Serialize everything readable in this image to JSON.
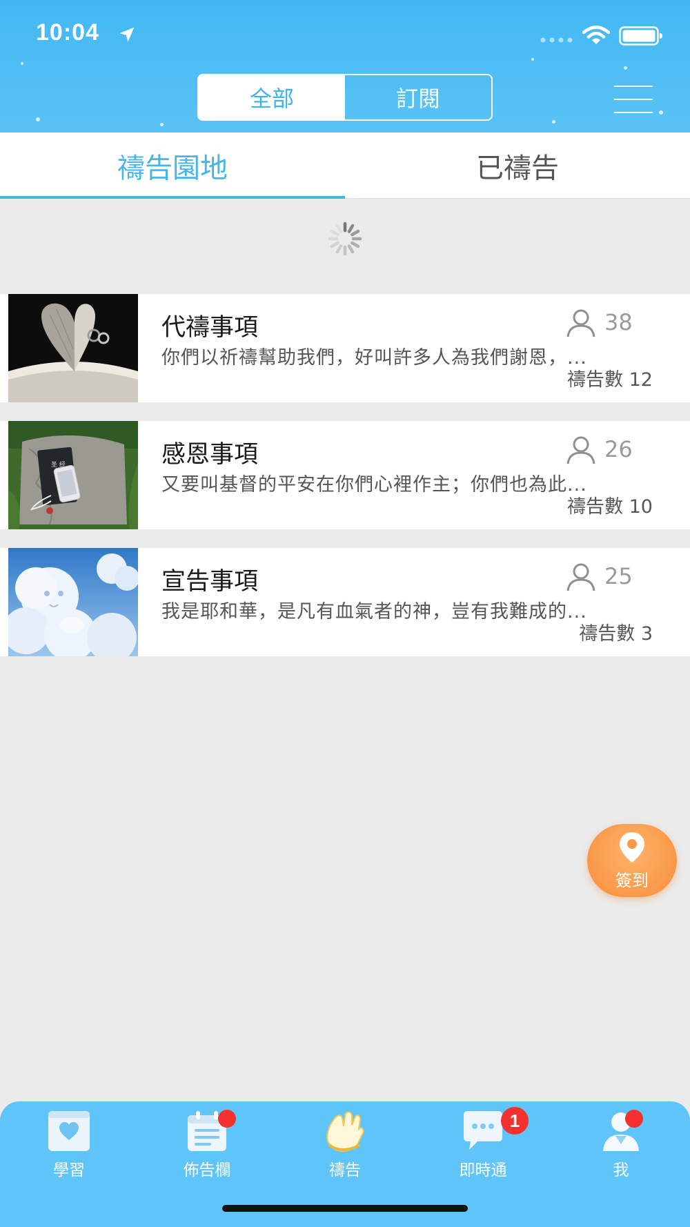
{
  "status_bar": {
    "time": "10:04"
  },
  "header": {
    "segments": [
      {
        "label": "全部",
        "active": true
      },
      {
        "label": "訂閱",
        "active": false
      }
    ],
    "icons": [
      "location-arrow-icon",
      "signal-icon",
      "wifi-icon",
      "battery-icon",
      "menu-icon"
    ]
  },
  "tabs": [
    {
      "label": "禱告園地",
      "active": true
    },
    {
      "label": "已禱告",
      "active": false
    }
  ],
  "prayer_groups": [
    {
      "title": "代禱事項",
      "members": "38",
      "description": "你們以祈禱幫助我們，好叫許多人為我們謝恩，...",
      "prayer_count": "禱告數 12",
      "image": "open-bible-heart-image"
    },
    {
      "title": "感恩事項",
      "members": "26",
      "description": "又要叫基督的平安在你們心裡作主；你們也為此...",
      "prayer_count": "禱告數 10",
      "image": "bible-and-phone-image"
    },
    {
      "title": "宣告事項",
      "members": "25",
      "description": "我是耶和華，是凡有血氣者的神，豈有我難成的...",
      "prayer_count": "禱告數 3",
      "image": "lion-cloud-image"
    }
  ],
  "checkin": {
    "label": "簽到",
    "icon": "map-pin-icon"
  },
  "bottom_nav": [
    {
      "label": "學習",
      "icon": "heart-book-icon",
      "badge": ""
    },
    {
      "label": "佈告欄",
      "icon": "calendar-note-icon",
      "badge": "dot"
    },
    {
      "label": "禱告",
      "icon": "praying-hands-icon",
      "badge": ""
    },
    {
      "label": "即時通",
      "icon": "chat-bubble-icon",
      "badge": "1"
    },
    {
      "label": "我",
      "icon": "user-icon",
      "badge": "dot"
    }
  ],
  "colors": {
    "accent": "#45b6ea",
    "header_bg": "#42b8f3",
    "nav_bg": "#5fc5f8",
    "checkin": "#f99848",
    "badge": "#f2302e"
  }
}
